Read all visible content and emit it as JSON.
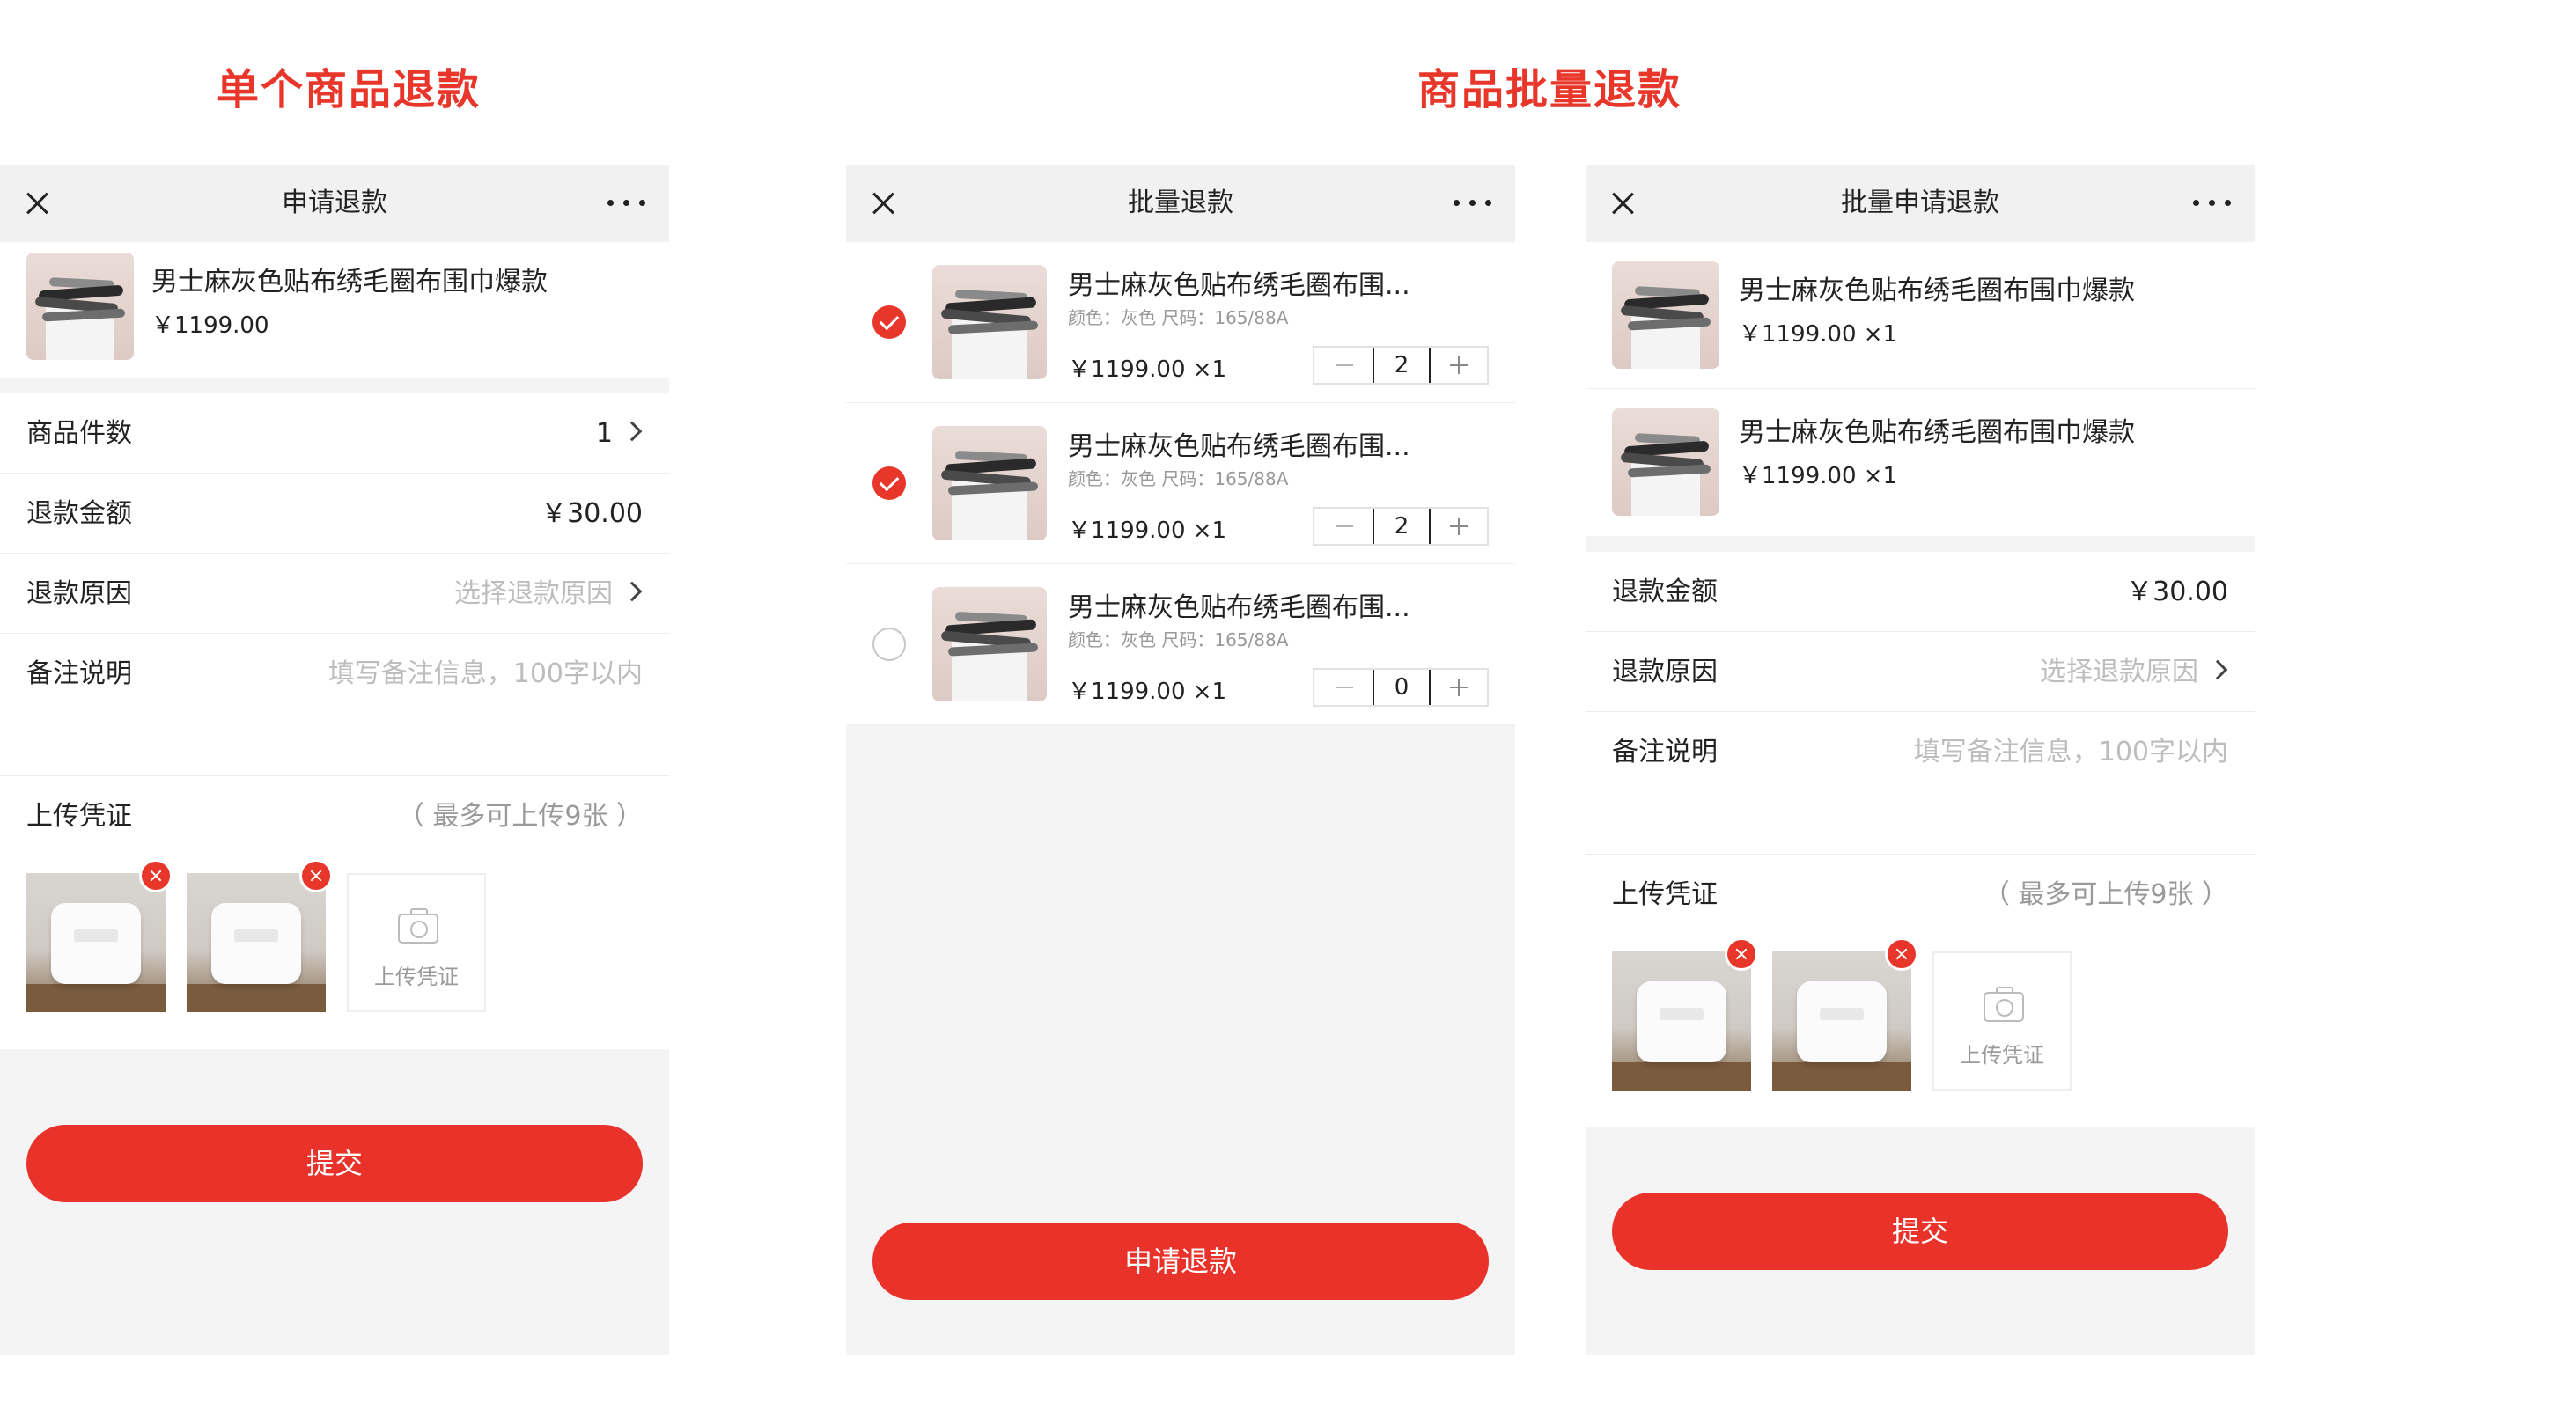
{
  "titles": {
    "single": "单个商品退款",
    "batch": "商品批量退款"
  },
  "single": {
    "nav_title": "申请退款",
    "product": {
      "name": "男士麻灰色贴布绣毛圈布围巾爆款",
      "price": "￥1199.00"
    },
    "rows": {
      "count_label": "商品件数",
      "count_value": "1",
      "amount_label": "退款金额",
      "amount_value": "￥30.00",
      "reason_label": "退款原因",
      "reason_placeholder": "选择退款原因",
      "remark_label": "备注说明",
      "remark_placeholder": "填写备注信息，100字以内"
    },
    "upload": {
      "label": "上传凭证",
      "hint": "（ 最多可上传9张 ）",
      "tile_label": "上传凭证"
    },
    "submit": "提交"
  },
  "batch_select": {
    "nav_title": "批量退款",
    "items": [
      {
        "name": "男士麻灰色贴布绣毛圈布围...",
        "spec": "颜色：灰色   尺码：165/88A",
        "price": "￥1199.00 ×1",
        "qty": "2",
        "checked": true
      },
      {
        "name": "男士麻灰色贴布绣毛圈布围...",
        "spec": "颜色：灰色   尺码：165/88A",
        "price": "￥1199.00 ×1",
        "qty": "2",
        "checked": true
      },
      {
        "name": "男士麻灰色贴布绣毛圈布围...",
        "spec": "颜色：灰色   尺码：165/88A",
        "price": "￥1199.00 ×1",
        "qty": "0",
        "checked": false
      }
    ],
    "submit": "申请退款"
  },
  "batch_apply": {
    "nav_title": "批量申请退款",
    "products": [
      {
        "name": "男士麻灰色贴布绣毛圈布围巾爆款",
        "price": "￥1199.00 ×1"
      },
      {
        "name": "男士麻灰色贴布绣毛圈布围巾爆款",
        "price": "￥1199.00 ×1"
      }
    ],
    "rows": {
      "amount_label": "退款金额",
      "amount_value": "￥30.00",
      "reason_label": "退款原因",
      "reason_placeholder": "选择退款原因",
      "remark_label": "备注说明",
      "remark_placeholder": "填写备注信息，100字以内"
    },
    "upload": {
      "label": "上传凭证",
      "hint": "（ 最多可上传9张 ）",
      "tile_label": "上传凭证"
    },
    "submit": "提交"
  },
  "colors": {
    "accent": "#e8322a",
    "background": "#f4f4f4",
    "navbar": "#f1f1f1"
  },
  "icons": [
    "close-icon",
    "more-icon",
    "chevron-right-icon",
    "camera-icon",
    "delete-badge-icon",
    "check-circle-icon",
    "minus-icon",
    "plus-icon"
  ]
}
